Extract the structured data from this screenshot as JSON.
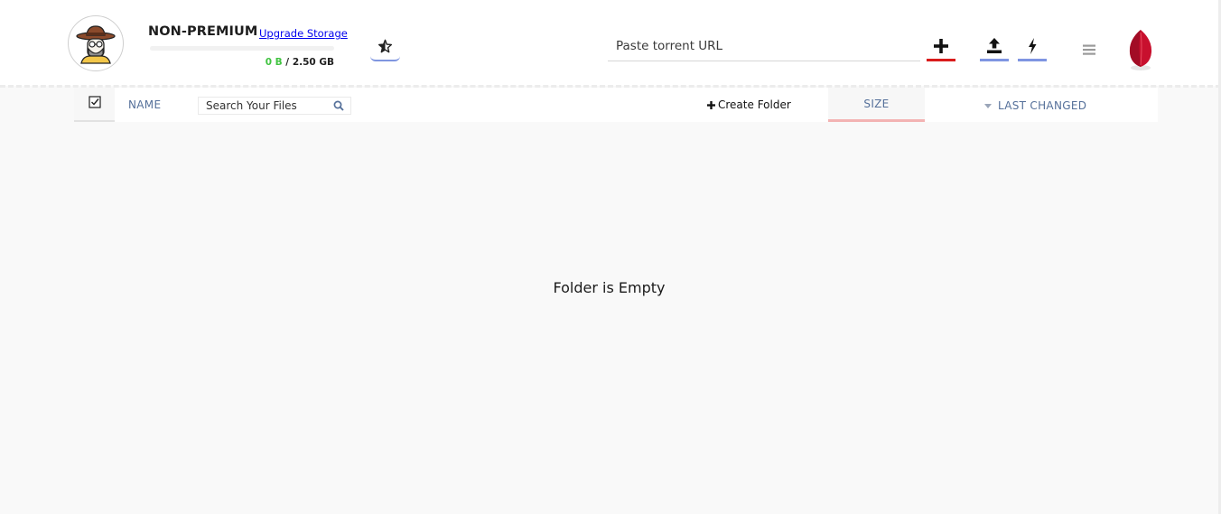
{
  "account": {
    "plan": "NON-PREMIUM",
    "upgrade_label": "Upgrade Storage",
    "storage_used": "0 B",
    "storage_separator": " / ",
    "storage_total": "2.50 GB",
    "storage_fraction": 0.0
  },
  "header": {
    "torrent_placeholder": "Paste torrent URL",
    "icons": {
      "avatar": "cowboy-avatar-icon",
      "star": "star-icon",
      "add": "plus-icon",
      "upload": "upload-icon",
      "bolt": "lightning-icon",
      "menu": "hamburger-menu-icon",
      "logo": "seed-logo-icon"
    }
  },
  "file_list": {
    "name_header": "NAME",
    "search_placeholder": "Search Your Files",
    "create_folder_label": "Create Folder",
    "size_header": "SIZE",
    "last_changed_header": "LAST CHANGED",
    "empty_message": "Folder is Empty"
  },
  "colors": {
    "add_accent": "#d91c1c",
    "tool_accent": "#7f95e2",
    "used_storage": "#41c341",
    "header_text": "#55709a",
    "logo_red": "#c8102e"
  }
}
